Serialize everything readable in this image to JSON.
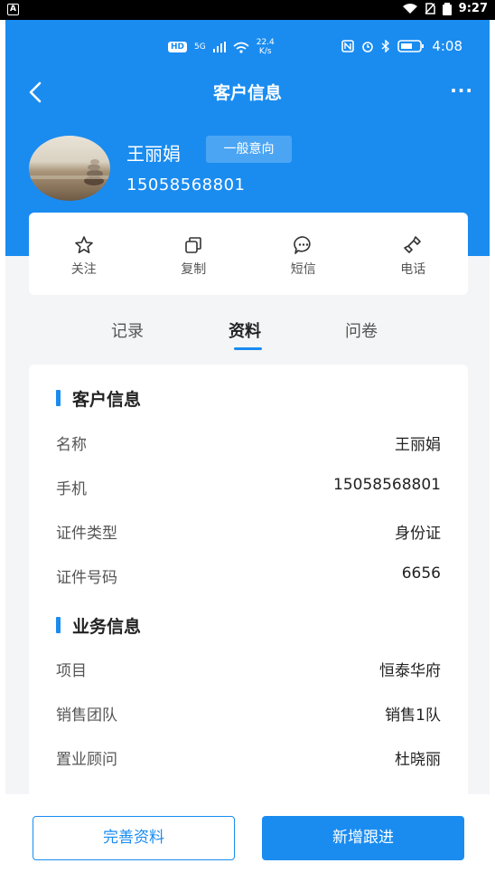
{
  "outer_status": {
    "app_badge": "A",
    "time": "9:27"
  },
  "inner_status": {
    "hd": "HD",
    "network": "5G",
    "speed": "22.4",
    "speed_unit": "K/s",
    "time": "4:08"
  },
  "nav": {
    "title": "客户信息",
    "more": "···"
  },
  "customer": {
    "name": "王丽娟",
    "intent_tag": "一般意向",
    "phone": "15058568801"
  },
  "actions": [
    {
      "label": "关注",
      "icon": "star-icon"
    },
    {
      "label": "复制",
      "icon": "copy-icon"
    },
    {
      "label": "短信",
      "icon": "message-icon"
    },
    {
      "label": "电话",
      "icon": "phone-icon"
    }
  ],
  "tabs": [
    {
      "label": "记录",
      "active": false
    },
    {
      "label": "资料",
      "active": true
    },
    {
      "label": "问卷",
      "active": false
    }
  ],
  "customer_info": {
    "title": "客户信息",
    "rows": [
      {
        "label": "名称",
        "value": "王丽娟"
      },
      {
        "label": "手机",
        "value": "15058568801"
      },
      {
        "label": "证件类型",
        "value": "身份证"
      },
      {
        "label": "证件号码",
        "value": "6656"
      }
    ]
  },
  "business_info": {
    "title": "业务信息",
    "rows": [
      {
        "label": "项目",
        "value": "恒泰华府"
      },
      {
        "label": "销售团队",
        "value": "销售1队"
      },
      {
        "label": "置业顾问",
        "value": "杜晓丽"
      }
    ]
  },
  "bottom": {
    "complete_label": "完善资料",
    "add_follow_label": "新增跟进"
  },
  "colors": {
    "primary": "#1a8cf0"
  }
}
